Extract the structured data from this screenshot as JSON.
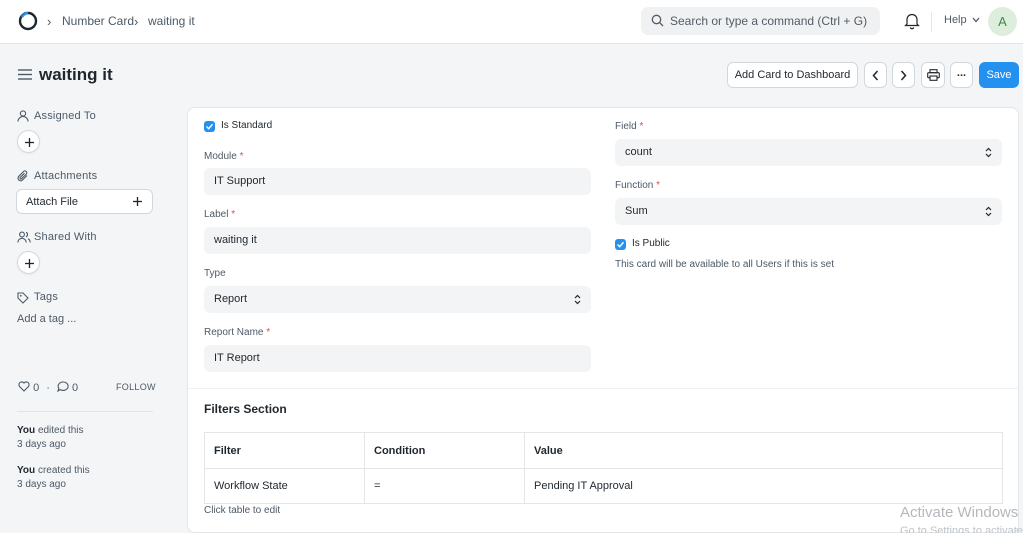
{
  "navbar": {
    "breadcrumbs": [
      "Number Card",
      "waiting it"
    ],
    "search_placeholder": "Search or type a command (Ctrl + G)",
    "help_label": "Help",
    "avatar_initial": "A"
  },
  "page": {
    "title": "waiting it",
    "buttons": {
      "add_to_dashboard": "Add Card to Dashboard",
      "more": "...",
      "save": "Save"
    }
  },
  "sidebar": {
    "assigned_to": "Assigned To",
    "attachments": "Attachments",
    "attach_file": "Attach File",
    "shared_with": "Shared With",
    "tags": "Tags",
    "add_tag": "Add a tag ...",
    "likes": "0",
    "comments": "0",
    "separator": "·",
    "follow": "FOLLOW",
    "activity": [
      {
        "user": "You",
        "action": "edited this",
        "time": "3 days ago"
      },
      {
        "user": "You",
        "action": "created this",
        "time": "3 days ago"
      }
    ]
  },
  "form": {
    "is_standard": {
      "label": "Is Standard",
      "checked": true
    },
    "module": {
      "label": "Module",
      "required": "*",
      "value": "IT Support"
    },
    "label_field": {
      "label": "Label",
      "required": "*",
      "value": "waiting it"
    },
    "type": {
      "label": "Type",
      "value": "Report"
    },
    "report_name": {
      "label": "Report Name",
      "required": "*",
      "value": "IT Report"
    },
    "field": {
      "label": "Field",
      "required": "*",
      "value": "count"
    },
    "function": {
      "label": "Function",
      "required": "*",
      "value": "Sum"
    },
    "is_public": {
      "label": "Is Public",
      "checked": true
    },
    "public_hint": "This card will be available to all Users if this is set"
  },
  "filters": {
    "title": "Filters Section",
    "columns": [
      "Filter",
      "Condition",
      "Value"
    ],
    "rows": [
      [
        "Workflow State",
        "=",
        "Pending IT Approval"
      ]
    ],
    "hint": "Click table to edit"
  },
  "watermark": {
    "line1": "Activate Windows",
    "line2": "Go to Settings to activate Windows."
  },
  "colors": {
    "primary": "#2490ef",
    "required": "#e24c4c",
    "avatar_bg": "#ddeedd",
    "avatar_text": "#3b8a4a"
  }
}
